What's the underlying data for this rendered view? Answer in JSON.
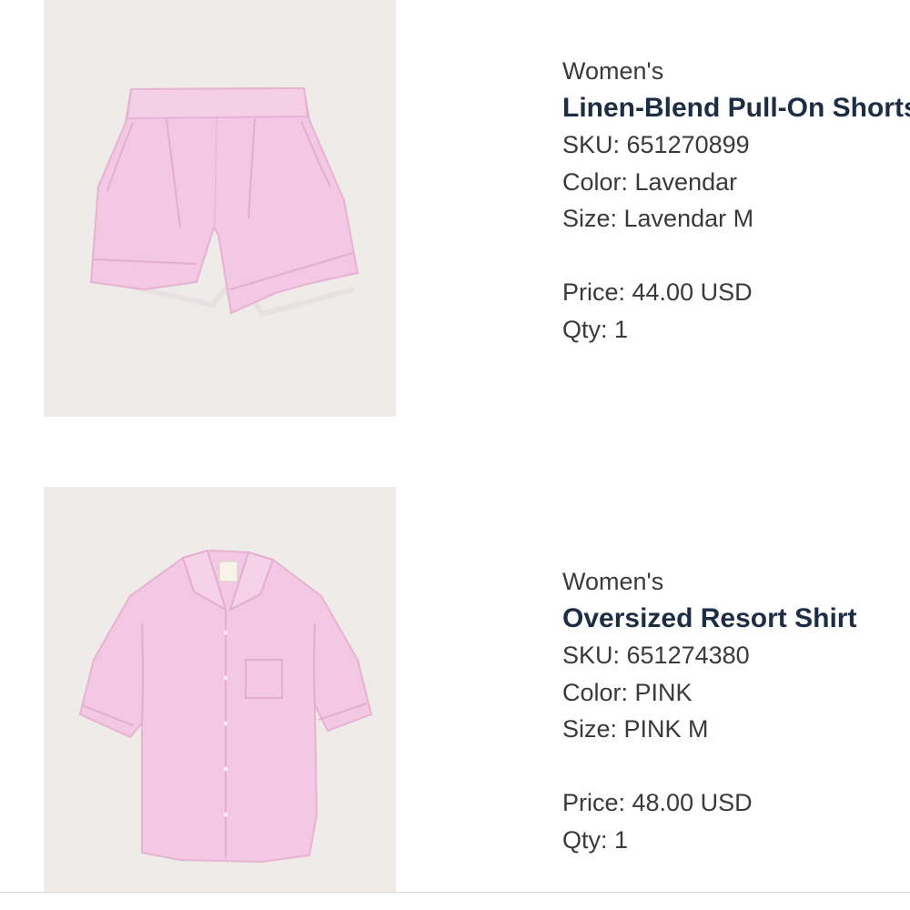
{
  "items": [
    {
      "category": "Women's",
      "name": "Linen-Blend Pull-On Shorts",
      "sku": "SKU: 651270899",
      "color": "Color: Lavendar",
      "size": "Size: Lavendar M",
      "price": "Price: 44.00 USD",
      "qty": "Qty: 1",
      "image_icon": "shorts-image",
      "garment_color": "#f2c8e2"
    },
    {
      "category": "Women's",
      "name": "Oversized Resort Shirt",
      "sku": "SKU: 651274380",
      "color": "Color: PINK",
      "size": "Size: PINK M",
      "price": "Price: 48.00 USD",
      "qty": "Qty: 1",
      "image_icon": "shirt-image",
      "garment_color": "#f2c8e2"
    }
  ],
  "colors": {
    "title": "#1d2d44",
    "text": "#3a3a3a",
    "photo_background": "#efebe9"
  }
}
